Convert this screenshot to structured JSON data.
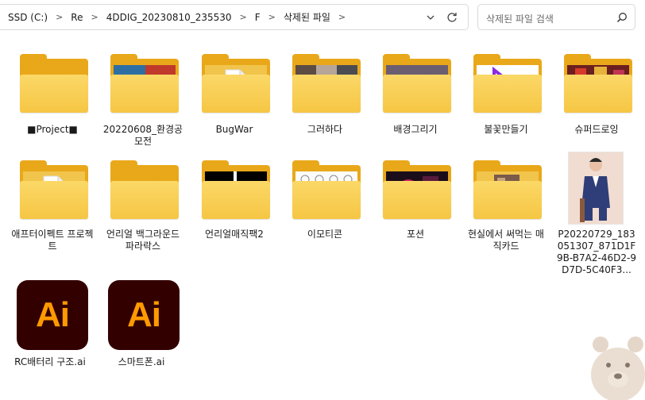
{
  "address_bar": {
    "breadcrumbs": [
      "SSD (C:)",
      "Re",
      "4DDIG_20230810_235530",
      "F",
      "삭제된 파일"
    ]
  },
  "search": {
    "placeholder": "삭제된 파일 검색"
  },
  "items": [
    {
      "label": "■Project■",
      "type": "folder"
    },
    {
      "label": "20220608_환경공모전",
      "type": "folder"
    },
    {
      "label": "BugWar",
      "type": "folder"
    },
    {
      "label": "그러하다",
      "type": "folder"
    },
    {
      "label": "배경그리기",
      "type": "folder"
    },
    {
      "label": "불꽃만들기",
      "type": "folder"
    },
    {
      "label": "슈퍼드로잉",
      "type": "folder"
    },
    {
      "label": "애프터이펙트 프로젝트",
      "type": "folder"
    },
    {
      "label": "언리얼 백그라운드 파라락스",
      "type": "folder"
    },
    {
      "label": "언리얼매직팩2",
      "type": "folder"
    },
    {
      "label": "이모티콘",
      "type": "folder"
    },
    {
      "label": "포션",
      "type": "folder"
    },
    {
      "label": "현실에서 써먹는 매직카드",
      "type": "folder"
    },
    {
      "label": "P20220729_183051307_871D1F9B-B7A2-46D2-9D7D-5C40F3...",
      "type": "image"
    },
    {
      "label": "RC배터리 구조.ai",
      "type": "ai",
      "icon_text": "Ai"
    },
    {
      "label": "스마트폰.ai",
      "type": "ai",
      "icon_text": "Ai"
    }
  ],
  "colors": {
    "folder_front": "#f6c644",
    "folder_back": "#e9a81a",
    "ai_bg": "#330000",
    "ai_text": "#ff9a00"
  }
}
